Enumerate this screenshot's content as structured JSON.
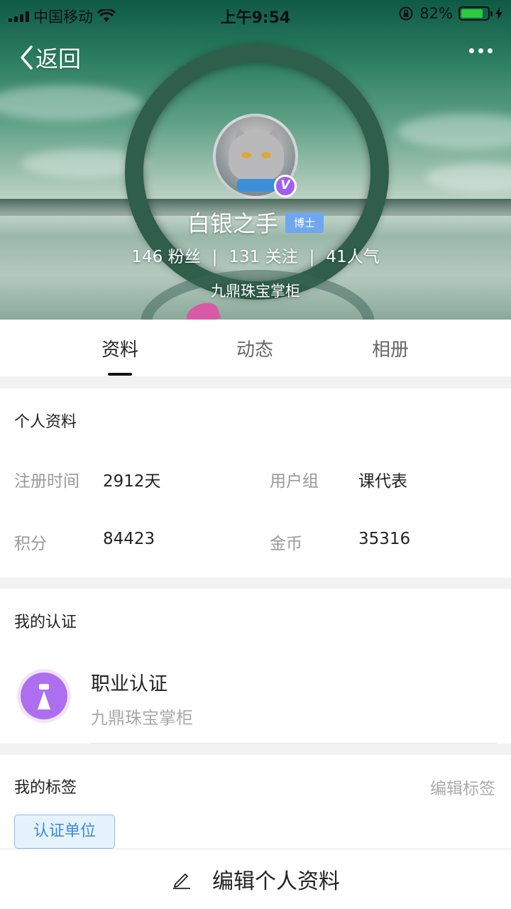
{
  "status_bar": {
    "carrier": "中国移动",
    "time": "上午9:54",
    "battery_percent": "82%",
    "battery_level": 0.82,
    "battery_color": "#2ccc3c"
  },
  "nav": {
    "back_label": "返回",
    "back_icon": "chevron-left-icon",
    "more_icon": "more-dots-icon"
  },
  "profile": {
    "username": "白银之手",
    "rank_badge": "博士",
    "verified_badge": "V",
    "verified_color": "#a15ef0",
    "fans": "146 粉丝",
    "following": "131 关注",
    "popularity": "41人气",
    "stats_separator": "|",
    "organization": "九鼎珠宝掌柜"
  },
  "tabs": [
    {
      "label": "资料",
      "active": true
    },
    {
      "label": "动态",
      "active": false
    },
    {
      "label": "相册",
      "active": false
    }
  ],
  "personal_info": {
    "title": "个人资料",
    "fields": [
      {
        "label": "注册时间",
        "value": "2912天"
      },
      {
        "label": "用户组",
        "value": "课代表"
      },
      {
        "label": "积分",
        "value": "84423"
      },
      {
        "label": "金币",
        "value": "35316"
      }
    ]
  },
  "certification": {
    "title": "我的认证",
    "item_title": "职业认证",
    "item_subtitle": "九鼎珠宝掌柜",
    "icon": "necktie-icon",
    "icon_color": "#ae6ef0"
  },
  "tags": {
    "title": "我的标签",
    "edit_label": "编辑标签",
    "items": [
      "认证单位"
    ],
    "chip_color": "#3b8ad8"
  },
  "bottom_bar": {
    "label": "编辑个人资料",
    "icon": "pencil-icon"
  }
}
